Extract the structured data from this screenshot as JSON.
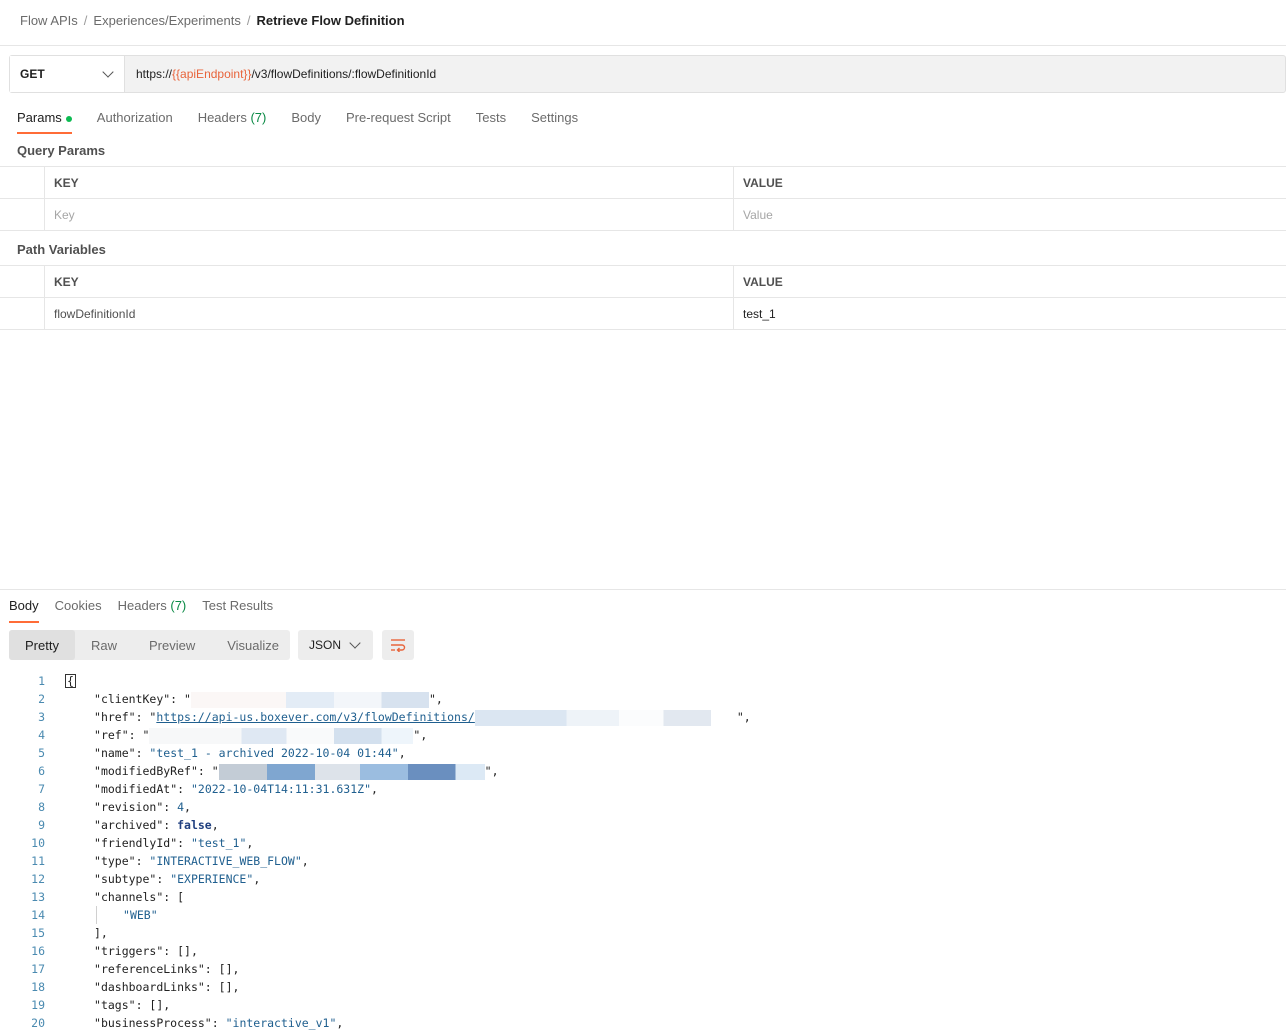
{
  "breadcrumb": {
    "items": [
      "Flow APIs",
      "Experiences/Experiments"
    ],
    "current": "Retrieve Flow Definition",
    "separator": "/"
  },
  "request": {
    "method": "GET",
    "url_prefix": "https://",
    "url_var": "{{apiEndpoint}}",
    "url_suffix": "/v3/flowDefinitions/:flowDefinitionId"
  },
  "request_tabs": [
    {
      "label": "Params",
      "active": true,
      "dot": true
    },
    {
      "label": "Authorization"
    },
    {
      "label": "Headers",
      "count": "(7)"
    },
    {
      "label": "Body"
    },
    {
      "label": "Pre-request Script"
    },
    {
      "label": "Tests"
    },
    {
      "label": "Settings"
    }
  ],
  "query_params": {
    "title": "Query Params",
    "key_header": "KEY",
    "value_header": "VALUE",
    "key_placeholder": "Key",
    "value_placeholder": "Value"
  },
  "path_variables": {
    "title": "Path Variables",
    "key_header": "KEY",
    "value_header": "VALUE",
    "row_key": "flowDefinitionId",
    "row_value": "test_1"
  },
  "response_tabs": [
    {
      "label": "Body",
      "active": true
    },
    {
      "label": "Cookies"
    },
    {
      "label": "Headers",
      "count": "(7)"
    },
    {
      "label": "Test Results"
    }
  ],
  "view_modes": [
    "Pretty",
    "Raw",
    "Preview",
    "Visualize"
  ],
  "active_view": "Pretty",
  "format": "JSON",
  "icons": [
    "chevron-down-icon",
    "wrap-lines-icon"
  ],
  "colors": {
    "accent": "#ff6c37",
    "variable": "#e8643b",
    "success": "#0cbb52"
  },
  "code_lines": [
    {
      "n": "1",
      "text": "{"
    },
    {
      "n": "2",
      "key": "clientKey",
      "redacted": true
    },
    {
      "n": "3",
      "key": "href",
      "link": "https://api-us.boxever.com/v3/flowDefinitions/",
      "redacted": true
    },
    {
      "n": "4",
      "key": "ref",
      "redacted": true
    },
    {
      "n": "5",
      "key": "name",
      "str": "test_1 - archived 2022-10-04 01:44"
    },
    {
      "n": "6",
      "key": "modifiedByRef",
      "redacted": true
    },
    {
      "n": "7",
      "key": "modifiedAt",
      "str": "2022-10-04T14:11:31.631Z"
    },
    {
      "n": "8",
      "key": "revision",
      "num": "4"
    },
    {
      "n": "9",
      "key": "archived",
      "bool": "false"
    },
    {
      "n": "10",
      "key": "friendlyId",
      "str": "test_1"
    },
    {
      "n": "11",
      "key": "type",
      "str": "INTERACTIVE_WEB_FLOW"
    },
    {
      "n": "12",
      "key": "subtype",
      "str": "EXPERIENCE"
    },
    {
      "n": "13",
      "key": "channels",
      "open": "["
    },
    {
      "n": "14",
      "item": "WEB"
    },
    {
      "n": "15",
      "text": "],"
    },
    {
      "n": "16",
      "key": "triggers",
      "raw": "[]"
    },
    {
      "n": "17",
      "key": "referenceLinks",
      "raw": "[]"
    },
    {
      "n": "18",
      "key": "dashboardLinks",
      "raw": "[]"
    },
    {
      "n": "19",
      "key": "tags",
      "raw": "[]"
    },
    {
      "n": "20",
      "key": "businessProcess",
      "str": "interactive_v1"
    }
  ]
}
